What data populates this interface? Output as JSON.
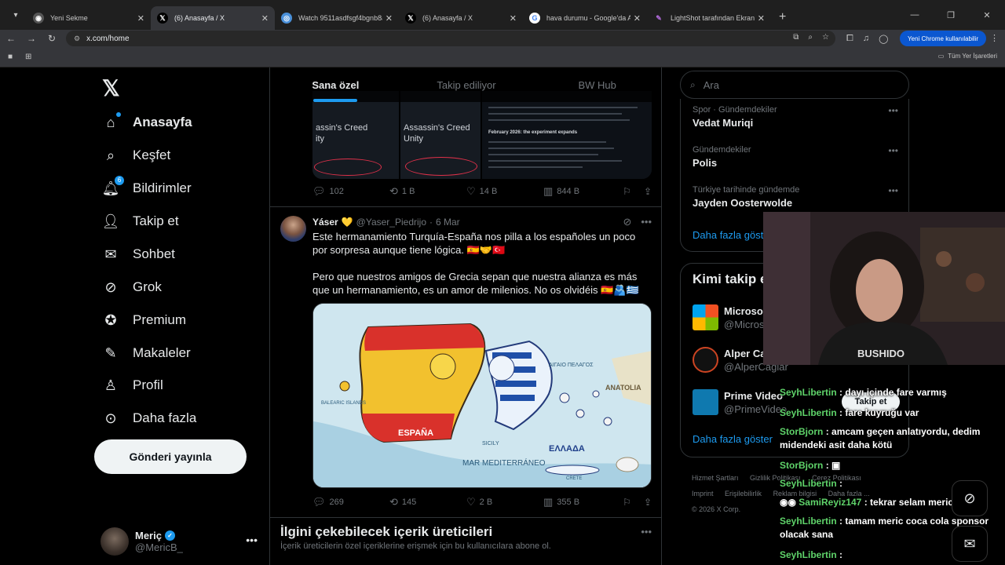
{
  "browser": {
    "tabs": [
      {
        "title": "Yeni Sekme",
        "active": false
      },
      {
        "title": "(6) Anasayfa / X",
        "active": true
      },
      {
        "title": "Watch 9511asdfsgf4bgnb8a9w",
        "active": false
      },
      {
        "title": "(6) Anasayfa / X",
        "active": false
      },
      {
        "title": "hava durumu - Google'da Ara",
        "active": false
      },
      {
        "title": "LightShot tarafından Ekran Gör",
        "active": false
      }
    ],
    "url": "x.com/home",
    "profile_label": "Yeni Chrome kullanılabilir",
    "bookmarks_all": "Tüm Yer İşaretleri"
  },
  "nav": {
    "items": [
      {
        "label": "Anasayfa",
        "icon": "home-icon"
      },
      {
        "label": "Keşfet",
        "icon": "search-icon"
      },
      {
        "label": "Bildirimler",
        "icon": "bell-icon",
        "badge": "6"
      },
      {
        "label": "Takip et",
        "icon": "person-add-icon"
      },
      {
        "label": "Sohbet",
        "icon": "mail-icon"
      },
      {
        "label": "Grok",
        "icon": "grok-icon"
      },
      {
        "label": "Premium",
        "icon": "premium-icon"
      },
      {
        "label": "Makaleler",
        "icon": "article-icon"
      },
      {
        "label": "Profil",
        "icon": "person-icon"
      },
      {
        "label": "Daha fazla",
        "icon": "more-circle-icon"
      }
    ],
    "post_button": "Gönderi yayınla",
    "account": {
      "name": "Meriç",
      "handle": "@MericB_"
    }
  },
  "feed": {
    "tabs": [
      "Sana özel",
      "Takip ediliyor",
      "BW Hub"
    ],
    "tweet1": {
      "media_titles": [
        "assin's Creed\nity",
        "Assassin's Creed\nUnity"
      ],
      "media_heading": "February 2026: the experiment expands",
      "stats": {
        "replies": "102",
        "reposts": "1 B",
        "likes": "14 B",
        "views": "844 B"
      }
    },
    "tweet2": {
      "name": "Yáser",
      "handle": "@Yaser_Piedrijo",
      "date": "6 Mar",
      "text1": "Este hermanamiento Turquía-España nos pilla a los españoles un poco por sorpresa aunque tiene lógica. 🇪🇸🤝🇹🇷",
      "text2": "Pero que nuestros amigos de Grecia sepan que nuestra alianza es más que un hermanamiento, es un amor de milenios. No os olvidéis 🇪🇸🫂🇬🇷",
      "map_labels": {
        "espana": "ESPAÑA",
        "ellada": "ΕΛΛΑΔΑ",
        "anatolia": "ANATOLIA",
        "balearic": "BALEARIC ISLANDS",
        "sicily": "SICILY",
        "mar": "MAR MEDITERRÁNEO",
        "crete": "CRETE",
        "aigaio": "ΑΙΓΑΙΟ ΠΕΛΑΓΟΣ"
      },
      "stats": {
        "replies": "269",
        "reposts": "145",
        "likes": "2 B",
        "views": "355 B"
      }
    },
    "suggestions": {
      "title": "İlgini çekebilecek içerik üreticileri",
      "subtitle": "İçerik üreticilerin özel içeriklerine erişmek için bu kullanıcılara abone ol."
    }
  },
  "sidebar": {
    "search_placeholder": "Ara",
    "trends": [
      {
        "category": "Spor · Gündemdekiler",
        "name": "Vedat Muriqi"
      },
      {
        "category": "Gündemdekiler",
        "name": "Polis"
      },
      {
        "category": "Türkiye tarihinde gündemde",
        "name": "Jayden Oosterwolde"
      }
    ],
    "trends_more": "Daha fazla göster",
    "wtf_title": "Kimi takip e",
    "wtf": [
      {
        "name": "Microso",
        "handle": "@Micros"
      },
      {
        "name": "Alper Ca",
        "handle": "@AlperCağlar"
      },
      {
        "name": "Prime Video",
        "handle": "@PrimeVideo"
      }
    ],
    "follow_label": "Takip et",
    "wtf_more": "Daha fazla göster",
    "footer": [
      "Hizmet Şartları",
      "Gizlilik Politikası",
      "Çerez Politikası",
      "Imprint",
      "Erişilebilirlik",
      "Reklam bilgisi",
      "Daha fazla ...",
      "© 2026 X Corp."
    ]
  },
  "stream_chat": [
    {
      "user": "SeyhLibertin",
      "msg": ": dayı içinde fare varmış"
    },
    {
      "user": "SeyhLibertin",
      "msg": ": fare kuyruğu var"
    },
    {
      "user": "StorBjorn",
      "msg": ": amcam geçen anlatıyordu, dedim midendeki asit daha kötü"
    },
    {
      "user": "StorBjorn",
      "msg": ":"
    },
    {
      "user": "SeyhLibertin",
      "msg": ":"
    },
    {
      "user": "SamiReyiz147",
      "msg": ": tekrar selam mericb"
    },
    {
      "user": "SeyhLibertin",
      "msg": ": tamam meric coca cola sponsor olacak sana"
    },
    {
      "user": "SeyhLibertin",
      "msg": ":"
    }
  ],
  "cam_shirt_text": "BUSHIDO",
  "colors": {
    "accent": "#1d9bf0",
    "bg": "#000000",
    "border": "#2f3336",
    "muted": "#71767b",
    "chat_user": "#5fd36a"
  }
}
